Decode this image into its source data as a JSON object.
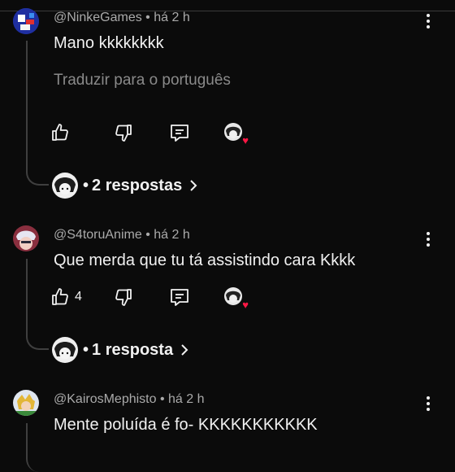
{
  "comments": [
    {
      "handle": "@NinkeGames",
      "time": "há 2 h",
      "text": "Mano kkkkkkkk",
      "translate": "Traduzir para o português",
      "likes": "",
      "replies": "2 respostas"
    },
    {
      "handle": "@S4toruAnime",
      "time": "há 2 h",
      "text": "Que merda que tu tá assistindo cara Kkkk",
      "likes": "4",
      "replies": "1 resposta"
    },
    {
      "handle": "@KairosMephisto",
      "time": "há 2 h",
      "text": "Mente poluída é fo- KKKKKKKKKKK"
    }
  ],
  "separator": "•",
  "colors": {
    "heart": "#ff1744",
    "background": "#0b0b0b",
    "muted": "#aaaaaa"
  },
  "icons": [
    "thumbs-up-icon",
    "thumbs-down-icon",
    "reply-icon",
    "creator-heart-icon",
    "more-vert-icon",
    "chevron-right-icon"
  ]
}
